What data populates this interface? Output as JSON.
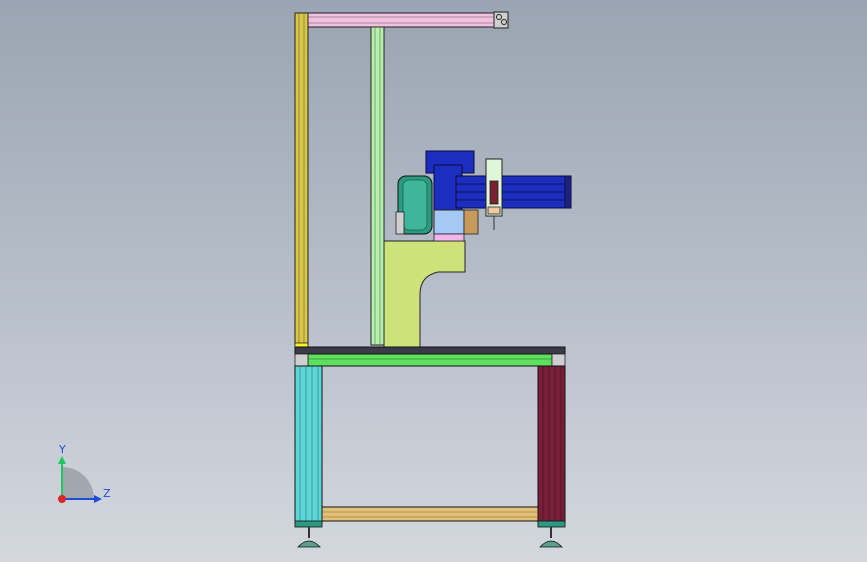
{
  "viewport": {
    "background_top": "#9aa4b2",
    "background_bottom": "#d4d8de"
  },
  "triad": {
    "y_label": "Y",
    "z_label": "Z",
    "y_color": "#22c55e",
    "z_color": "#1d4ed8",
    "origin_color": "#dc2626"
  },
  "colors": {
    "yellow_post": "#d8c84a",
    "pink_beam": "#f2c0e0",
    "green_post": "#b8f0b0",
    "lime_bracket": "#cfe27a",
    "blue_module": "#1c2ec0",
    "teal_motor": "#2a9a80",
    "cyan_leg": "#5fd6d6",
    "maroon_leg": "#7a1f3a",
    "green_rail": "#5ee05e",
    "tan_rail": "#e3c07a",
    "tabletop": "#3a3a48"
  }
}
